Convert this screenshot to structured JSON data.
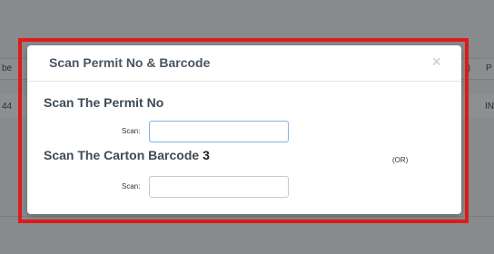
{
  "background": {
    "header_left": "be",
    "header_right": ".)",
    "header_far": "P",
    "row_left": "44",
    "row_right": "IN"
  },
  "modal": {
    "title": "Scan Permit No & Barcode",
    "close_symbol": "×",
    "permit": {
      "heading": "Scan The Permit No",
      "scan_label": "Scan:",
      "value": ""
    },
    "carton": {
      "heading": "Scan The Carton Barcode",
      "number": "3",
      "scan_label": "Scan:",
      "value": ""
    },
    "or_text": "(OR)"
  },
  "colors": {
    "highlight_border": "#e01b1b",
    "focus_border": "#7fb3e6",
    "overlay": "#888a8c"
  }
}
